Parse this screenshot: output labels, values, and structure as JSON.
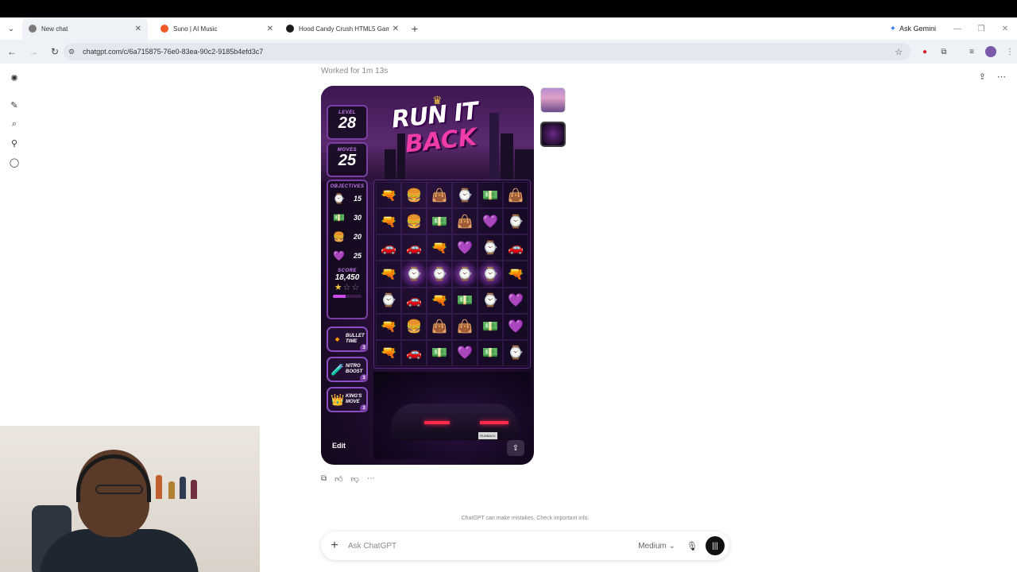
{
  "browser": {
    "tabs": [
      {
        "title": "New chat",
        "favicon_color": "#7a7a7a",
        "active": true
      },
      {
        "title": "Suno | AI Music",
        "favicon_color": "#f05a28",
        "active": false
      },
      {
        "title": "Hood Candy Crush HTML5 Gam",
        "favicon_color": "#1a1a1a",
        "active": false
      }
    ],
    "ask_gemini": "Ask Gemini",
    "url": "chatgpt.com/c/6a715875-76e0-83ea-90c2-9185b4efd3c7"
  },
  "chat": {
    "worked_for": "Worked for 1m 13s",
    "edit_label": "Edit",
    "disclaimer": "ChatGPT can make mistakes. Check important info.",
    "composer_placeholder": "Ask ChatGPT",
    "model_label": "Medium"
  },
  "game": {
    "title_line1": "RUN IT",
    "title_line2": "BACK",
    "level_label": "LEVEL",
    "level_value": "28",
    "moves_label": "MOVES",
    "moves_value": "25",
    "objectives_label": "OBJECTIVES",
    "objectives": [
      {
        "icon": "watch-icon",
        "glyph": "⌚",
        "count": "15"
      },
      {
        "icon": "cash-icon",
        "glyph": "💵",
        "count": "30"
      },
      {
        "icon": "grill-icon",
        "glyph": "🍔",
        "count": "20"
      },
      {
        "icon": "purple-gem-icon",
        "glyph": "💜",
        "count": "25"
      }
    ],
    "score_label": "SCORE",
    "score_value": "18,450",
    "stars_earned": 1,
    "stars_total": 3,
    "score_progress": 0.45,
    "powerups": [
      {
        "line1": "BULLET",
        "line2": "TIME",
        "count": "3",
        "icon": "bullet-icon",
        "glyph": "🔸"
      },
      {
        "line1": "NITRO",
        "line2": "BOOST",
        "count": "3",
        "icon": "nitro-bottle-icon",
        "glyph": "🧪"
      },
      {
        "line1": "KING'S",
        "line2": "MOVE",
        "count": "3",
        "icon": "crown-icon",
        "glyph": "👑"
      }
    ],
    "plate_text": "RUNBACK",
    "board": [
      [
        "gun",
        "grill",
        "bag",
        "watch",
        "cash",
        "bag"
      ],
      [
        "gun",
        "grill",
        "cash",
        "bag",
        "gem",
        "watch"
      ],
      [
        "car",
        "car",
        "gun",
        "gem",
        "watch",
        "car"
      ],
      [
        "gun",
        "watch",
        "watch",
        "watch",
        "watch",
        "gun"
      ],
      [
        "watch",
        "car",
        "gun",
        "cash",
        "watch",
        "gem"
      ],
      [
        "gun",
        "grill",
        "bag",
        "bag",
        "cash",
        "gem"
      ],
      [
        "gun",
        "car",
        "cash",
        "gem",
        "cash",
        "watch"
      ]
    ],
    "glow_row": 3,
    "tile_glyphs": {
      "gun": {
        "glyph": "🔫",
        "color": "#c04be0"
      },
      "grill": {
        "glyph": "🍔",
        "color": "#e0a530"
      },
      "bag": {
        "glyph": "👜",
        "color": "#4f9a3a"
      },
      "watch": {
        "glyph": "⌚",
        "color": "#e6b33c"
      },
      "cash": {
        "glyph": "💵",
        "color": "#5fae4a"
      },
      "gem": {
        "glyph": "💜",
        "color": "#9a3fd0"
      },
      "car": {
        "glyph": "🚗",
        "color": "#2f6fe0"
      }
    }
  }
}
